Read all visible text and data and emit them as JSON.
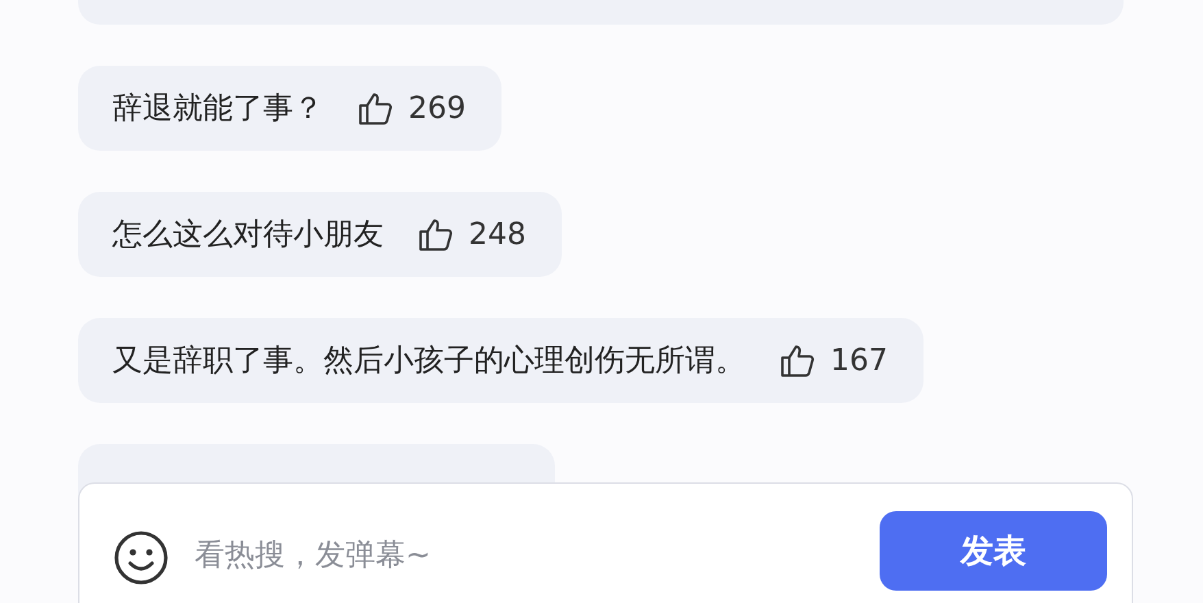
{
  "comments": [
    {
      "text": "辞退就能了事？",
      "likes": "269"
    },
    {
      "text": "怎么这么对待小朋友",
      "likes": "248"
    },
    {
      "text": "又是辞职了事。然后小孩子的心理创伤无所谓。",
      "likes": "167"
    }
  ],
  "composer": {
    "placeholder": "看热搜，发弹幕~",
    "button": "发表"
  }
}
